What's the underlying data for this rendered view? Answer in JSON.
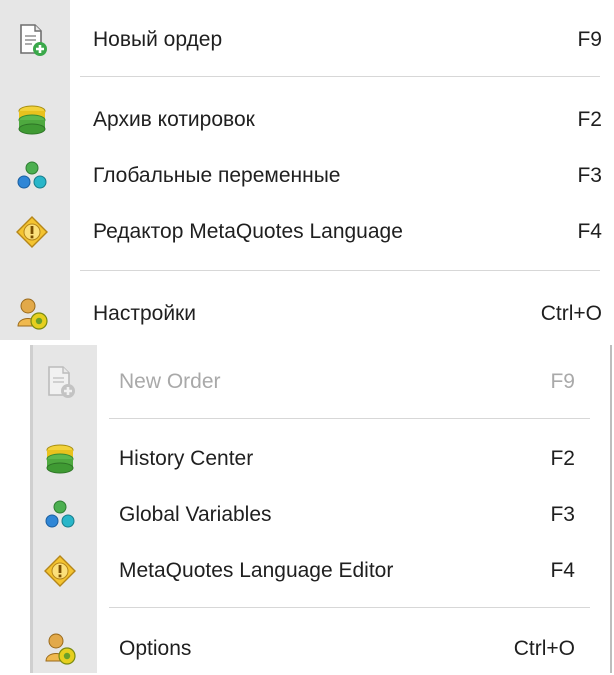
{
  "menu_ru": {
    "items": [
      {
        "label": "Новый ордер",
        "shortcut": "F9",
        "icon": "new-order-icon",
        "disabled": false
      },
      {
        "label": "Архив котировок",
        "shortcut": "F2",
        "icon": "history-center-icon",
        "disabled": false
      },
      {
        "label": "Глобальные переменные",
        "shortcut": "F3",
        "icon": "global-variables-icon",
        "disabled": false
      },
      {
        "label": "Редактор MetaQuotes Language",
        "shortcut": "F4",
        "icon": "metaeditor-icon",
        "disabled": false
      },
      {
        "label": "Настройки",
        "shortcut": "Ctrl+O",
        "icon": "options-icon",
        "disabled": false
      }
    ]
  },
  "menu_en": {
    "items": [
      {
        "label": "New Order",
        "shortcut": "F9",
        "icon": "new-order-icon",
        "disabled": true
      },
      {
        "label": "History Center",
        "shortcut": "F2",
        "icon": "history-center-icon",
        "disabled": false
      },
      {
        "label": "Global Variables",
        "shortcut": "F3",
        "icon": "global-variables-icon",
        "disabled": false
      },
      {
        "label": "MetaQuotes Language Editor",
        "shortcut": "F4",
        "icon": "metaeditor-icon",
        "disabled": false
      },
      {
        "label": "Options",
        "shortcut": "Ctrl+O",
        "icon": "options-icon",
        "disabled": false
      }
    ]
  },
  "colors": {
    "gutter": "#e6e6e6",
    "text": "#1f1f1f",
    "disabled_text": "#a9a9a9",
    "separator": "#d7d7d7"
  }
}
